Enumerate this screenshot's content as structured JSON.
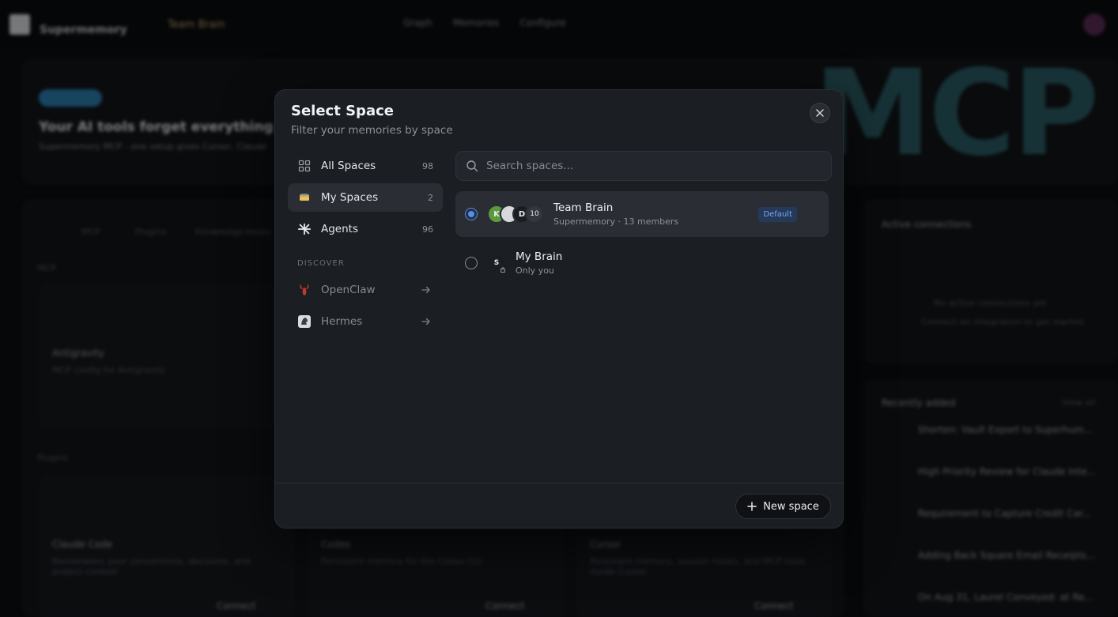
{
  "background": {
    "brand": "Supermemory",
    "team": "Team Brain",
    "nav": [
      "Graph",
      "Memories",
      "Configure"
    ],
    "hero_title": "Your AI tools forget everything betw",
    "hero_sub": "Supermemory MCP - one setup gives Cursor, Claude",
    "hero_big": "MCP",
    "filters": [
      "MCP",
      "Plugins",
      "Knowledge bases"
    ],
    "section_mcp": "MCP",
    "section_plugins": "Plugins",
    "antigravity_title": "Antigravity",
    "antigravity_desc": "MCP config for Antigravity",
    "claude_title": "Claude Code",
    "claude_desc": "Remembers your conventions, decisions, and project context",
    "codex_title": "Codex",
    "codex_desc": "Persistent memory for the Codex CLI",
    "cursor_title": "Cursor",
    "cursor_desc": "Persistent memory, session hooks, and MCP tools inside Cursor",
    "connect": "Connect",
    "active_connections": "Active connections",
    "no_active": "No active connections yet",
    "no_active_sub": "Connect an integration to get started",
    "recently_added": "Recently added",
    "view_all": "View all",
    "recent_items": [
      "Shorten: Vault Export to Superhum...",
      "High Priority Review for Claude Inte...",
      "Requirement to Capture Credit Car...",
      "Adding Back Square Email Receipts...",
      "On Aug 31, Laurel Conveyed: at Re..."
    ]
  },
  "modal": {
    "title": "Select Space",
    "subtitle": "Filter your memories by space",
    "close_label": "Close",
    "sidebar": {
      "items": [
        {
          "label": "All Spaces",
          "count": "98",
          "icon": "grid-icon"
        },
        {
          "label": "My Spaces",
          "count": "2",
          "icon": "folder-icon"
        },
        {
          "label": "Agents",
          "count": "96",
          "icon": "asterisk-icon"
        }
      ],
      "discover_label": "DISCOVER",
      "discover_items": [
        {
          "label": "OpenClaw",
          "icon": "lobster-icon"
        },
        {
          "label": "Hermes",
          "icon": "hermes-icon"
        }
      ]
    },
    "search": {
      "placeholder": "Search spaces..."
    },
    "spaces": [
      {
        "name": "Team Brain",
        "meta": "Supermemory · 13 members",
        "badge": "Default",
        "selected": true,
        "avatars": [
          "K",
          "",
          "D",
          "10"
        ]
      },
      {
        "name": "My Brain",
        "meta": "Only you",
        "selected": false,
        "avatars": [
          "S"
        ]
      }
    ],
    "new_space_label": "New space"
  },
  "colors": {
    "accent": "#4f8ff7",
    "badge_bg": "#253a5a",
    "badge_text": "#79a6ee",
    "modal_bg": "#1b1e23"
  }
}
